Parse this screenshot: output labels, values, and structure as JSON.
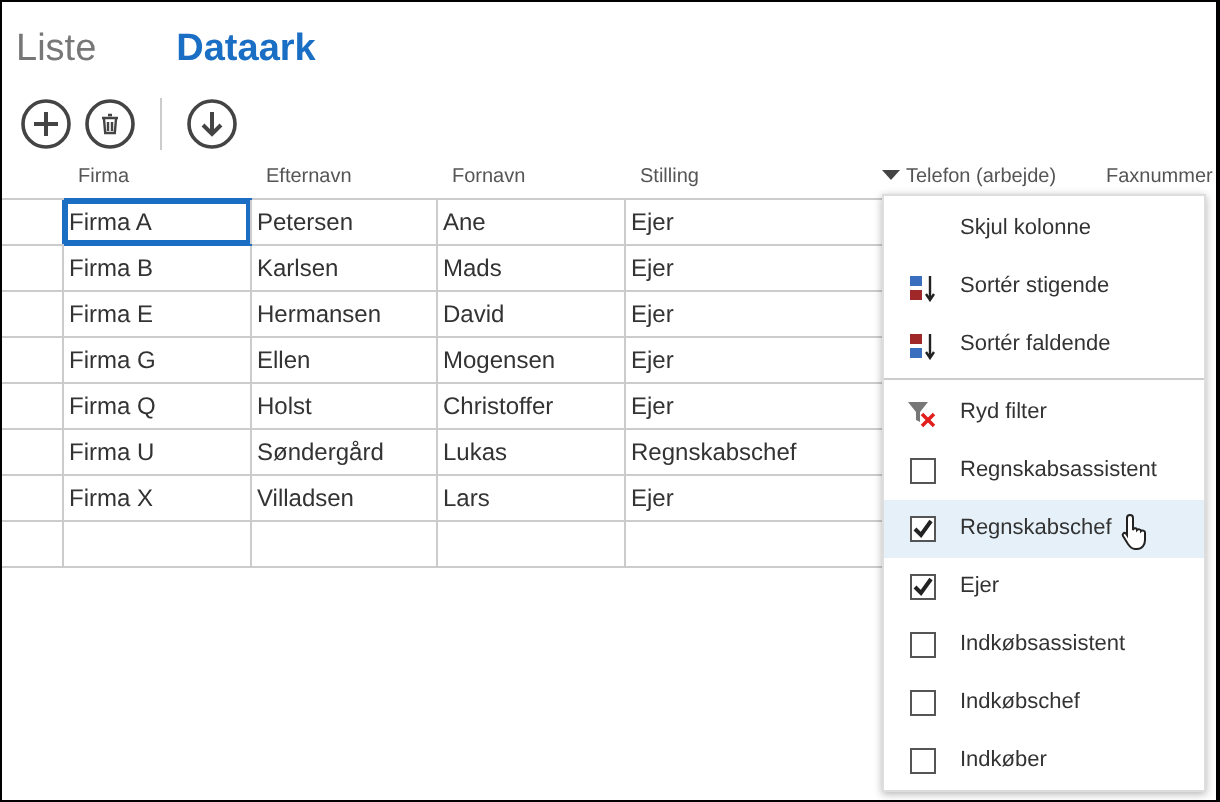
{
  "tabs": [
    {
      "label": "Liste",
      "selected": false
    },
    {
      "label": "Dataark",
      "selected": true
    }
  ],
  "columns": [
    {
      "label": "Firma",
      "menu_open": false
    },
    {
      "label": "Efternavn",
      "menu_open": false
    },
    {
      "label": "Fornavn",
      "menu_open": false
    },
    {
      "label": "Stilling",
      "menu_open": false
    },
    {
      "label": "Telefon (arbejde)",
      "menu_open": true
    },
    {
      "label": "Faxnummer",
      "menu_open": false
    }
  ],
  "rows": [
    {
      "cells": [
        {
          "text": "Firma A",
          "selected": true
        },
        {
          "text": "Petersen",
          "selected": false
        },
        {
          "text": "Ane",
          "selected": false
        },
        {
          "text": "Ejer",
          "selected": false
        }
      ]
    },
    {
      "cells": [
        {
          "text": "Firma B",
          "selected": false
        },
        {
          "text": "Karlsen",
          "selected": false
        },
        {
          "text": "Mads",
          "selected": false
        },
        {
          "text": "Ejer",
          "selected": false
        }
      ]
    },
    {
      "cells": [
        {
          "text": "Firma E",
          "selected": false
        },
        {
          "text": "Hermansen",
          "selected": false
        },
        {
          "text": "David",
          "selected": false
        },
        {
          "text": "Ejer",
          "selected": false
        }
      ]
    },
    {
      "cells": [
        {
          "text": "Firma G",
          "selected": false
        },
        {
          "text": "Ellen",
          "selected": false
        },
        {
          "text": "Mogensen",
          "selected": false
        },
        {
          "text": "Ejer",
          "selected": false
        }
      ]
    },
    {
      "cells": [
        {
          "text": "Firma Q",
          "selected": false
        },
        {
          "text": "Holst",
          "selected": false
        },
        {
          "text": "Christoffer",
          "selected": false
        },
        {
          "text": "Ejer",
          "selected": false
        }
      ]
    },
    {
      "cells": [
        {
          "text": "Firma U",
          "selected": false
        },
        {
          "text": "Søndergård",
          "selected": false
        },
        {
          "text": "Lukas",
          "selected": false
        },
        {
          "text": "Regnskabschef",
          "selected": false
        }
      ]
    },
    {
      "cells": [
        {
          "text": "Firma X",
          "selected": false
        },
        {
          "text": "Villadsen",
          "selected": false
        },
        {
          "text": "Lars",
          "selected": false
        },
        {
          "text": "Ejer",
          "selected": false
        }
      ]
    }
  ],
  "column_menu": {
    "items": [
      {
        "kind": "command",
        "label": "Skjul kolonne"
      },
      {
        "kind": "sort-ascending",
        "label": "Sortér stigende"
      },
      {
        "kind": "sort-descending",
        "label": "Sortér faldende"
      },
      {
        "kind": "separator"
      },
      {
        "kind": "clear-filter",
        "label": "Ryd filter"
      },
      {
        "kind": "filter",
        "label": "Regnskabsassistent",
        "checked": false,
        "hovered": false
      },
      {
        "kind": "filter",
        "label": "Regnskabschef",
        "checked": true,
        "hovered": true
      },
      {
        "kind": "filter",
        "label": "Ejer",
        "checked": true,
        "hovered": false
      },
      {
        "kind": "filter",
        "label": "Indkøbsassistent",
        "checked": false,
        "hovered": false
      },
      {
        "kind": "filter",
        "label": "Indkøbschef",
        "checked": false,
        "hovered": false
      },
      {
        "kind": "filter",
        "label": "Indkøber",
        "checked": false,
        "hovered": false
      }
    ]
  }
}
